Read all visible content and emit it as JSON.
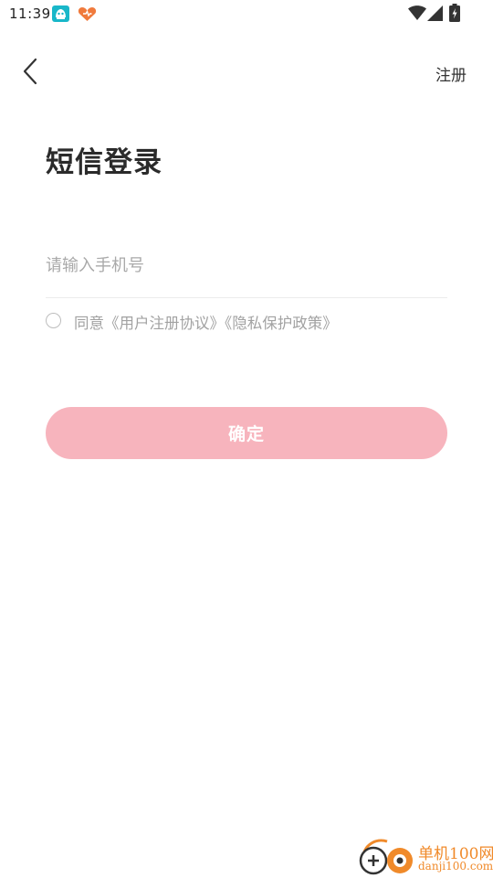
{
  "status_bar": {
    "time": "11:39",
    "icons": [
      "app-notification-icon",
      "heart-app-icon",
      "wifi-icon",
      "signal-icon",
      "battery-icon"
    ]
  },
  "nav": {
    "back_icon": "chevron-left-icon",
    "register_label": "注册"
  },
  "title": "短信登录",
  "phone_input": {
    "value": "",
    "placeholder": "请输入手机号"
  },
  "agreement": {
    "checked": false,
    "prefix": "同意",
    "user_agreement": "《用户注册协议》",
    "privacy_policy": "《隐私保护政策》"
  },
  "confirm_label": "确定",
  "watermark": {
    "title": "单机100网",
    "url": "danji100.com"
  },
  "colors": {
    "accent": "#f7b4bd",
    "text_primary": "#2b2b2b",
    "text_secondary": "#a2a2a2",
    "watermark": "#f08a2a"
  }
}
